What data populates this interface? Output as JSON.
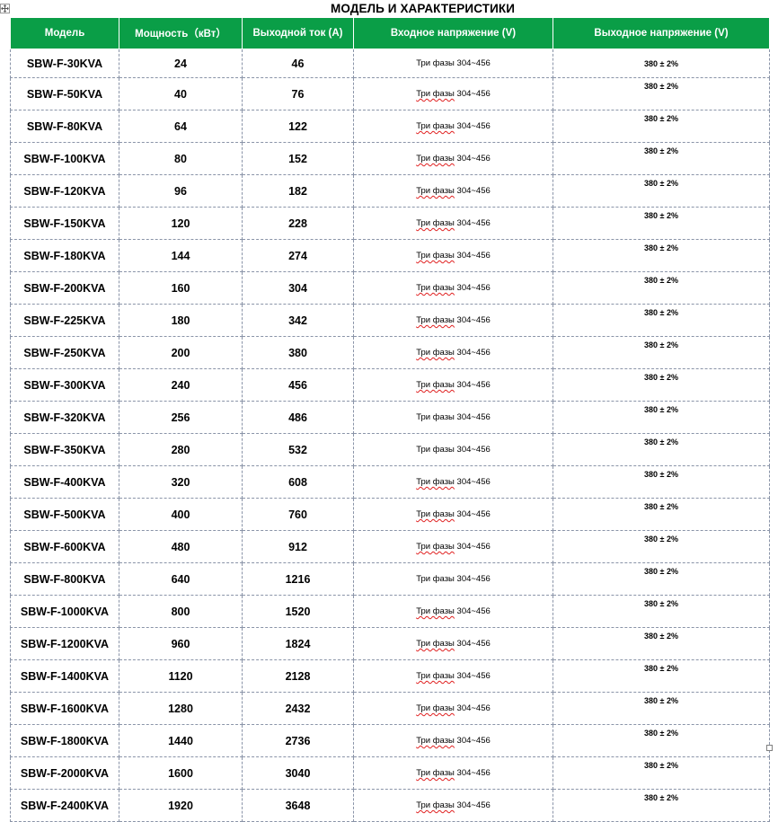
{
  "title": "МОДЕЛЬ И ХАРАКТЕРИСТИКИ",
  "headers": [
    "Модель",
    "Мощность（кВт）",
    "Выходной ток (A)",
    "Входное напряжение (V)",
    "Выходное напряжение (V)"
  ],
  "rows": [
    {
      "model": "SBW-F-30KVA",
      "power": "24",
      "current": "46",
      "input_prefix": "Три фазы",
      "input_range": "304~456",
      "output": "380 ± 2%"
    },
    {
      "model": "SBW-F-50KVA",
      "power": "40",
      "current": "76",
      "input_prefix": "Три фазы",
      "input_range": "304~456",
      "output": "380 ± 2%"
    },
    {
      "model": "SBW-F-80KVA",
      "power": "64",
      "current": "122",
      "input_prefix": "Три фазы",
      "input_range": "304~456",
      "output": "380 ± 2%"
    },
    {
      "model": "SBW-F-100KVA",
      "power": "80",
      "current": "152",
      "input_prefix": "Три фазы",
      "input_range": "304~456",
      "output": "380 ± 2%"
    },
    {
      "model": "SBW-F-120KVA",
      "power": "96",
      "current": "182",
      "input_prefix": "Три фазы",
      "input_range": "304~456",
      "output": "380 ± 2%"
    },
    {
      "model": "SBW-F-150KVA",
      "power": "120",
      "current": "228",
      "input_prefix": "Три фазы",
      "input_range": "304~456",
      "output": "380 ± 2%"
    },
    {
      "model": "SBW-F-180KVA",
      "power": "144",
      "current": "274",
      "input_prefix": "Три фазы",
      "input_range": "304~456",
      "output": "380 ± 2%"
    },
    {
      "model": "SBW-F-200KVA",
      "power": "160",
      "current": "304",
      "input_prefix": "Три фазы",
      "input_range": "304~456",
      "output": "380 ± 2%"
    },
    {
      "model": "SBW-F-225KVA",
      "power": "180",
      "current": "342",
      "input_prefix": "Три фазы",
      "input_range": "304~456",
      "output": "380 ± 2%"
    },
    {
      "model": "SBW-F-250KVA",
      "power": "200",
      "current": "380",
      "input_prefix": "Три фазы",
      "input_range": "304~456",
      "output": "380 ± 2%"
    },
    {
      "model": "SBW-F-300KVA",
      "power": "240",
      "current": "456",
      "input_prefix": "Три фазы",
      "input_range": "304~456",
      "output": "380 ± 2%"
    },
    {
      "model": "SBW-F-320KVA",
      "power": "256",
      "current": "486",
      "input_prefix": "Три фазы",
      "input_range": "304~456",
      "output": "380 ± 2%"
    },
    {
      "model": "SBW-F-350KVA",
      "power": "280",
      "current": "532",
      "input_prefix": "Три фазы",
      "input_range": "304~456",
      "output": "380 ± 2%"
    },
    {
      "model": "SBW-F-400KVA",
      "power": "320",
      "current": "608",
      "input_prefix": "Три фазы",
      "input_range": "304~456",
      "output": "380 ± 2%"
    },
    {
      "model": "SBW-F-500KVA",
      "power": "400",
      "current": "760",
      "input_prefix": "Три фазы",
      "input_range": "304~456",
      "output": "380 ± 2%"
    },
    {
      "model": "SBW-F-600KVA",
      "power": "480",
      "current": "912",
      "input_prefix": "Три фазы",
      "input_range": "304~456",
      "output": "380 ± 2%"
    },
    {
      "model": "SBW-F-800KVA",
      "power": "640",
      "current": "1216",
      "input_prefix": "Три фазы",
      "input_range": "304~456",
      "output": "380 ± 2%"
    },
    {
      "model": "SBW-F-1000KVA",
      "power": "800",
      "current": "1520",
      "input_prefix": "Три фазы",
      "input_range": "304~456",
      "output": "380 ± 2%"
    },
    {
      "model": "SBW-F-1200KVA",
      "power": "960",
      "current": "1824",
      "input_prefix": "Три фазы",
      "input_range": "304~456",
      "output": "380 ± 2%"
    },
    {
      "model": "SBW-F-1400KVA",
      "power": "1120",
      "current": "2128",
      "input_prefix": "Три фазы",
      "input_range": "304~456",
      "output": "380 ± 2%"
    },
    {
      "model": "SBW-F-1600KVA",
      "power": "1280",
      "current": "2432",
      "input_prefix": "Три фазы",
      "input_range": "304~456",
      "output": "380 ± 2%"
    },
    {
      "model": "SBW-F-1800KVA",
      "power": "1440",
      "current": "2736",
      "input_prefix": "Три фазы",
      "input_range": "304~456",
      "output": "380 ± 2%"
    },
    {
      "model": "SBW-F-2000KVA",
      "power": "1600",
      "current": "3040",
      "input_prefix": "Три фазы",
      "input_range": "304~456",
      "output": "380 ± 2%"
    },
    {
      "model": "SBW-F-2400KVA",
      "power": "1920",
      "current": "3648",
      "input_prefix": "Три фазы",
      "input_range": "304~456",
      "output": "380 ± 2%"
    }
  ],
  "spellcheck_flagged_rows": [
    1,
    2,
    3,
    4,
    5,
    6,
    7,
    8,
    9,
    10,
    13,
    14,
    15,
    17,
    18,
    19,
    20,
    21,
    22,
    23
  ],
  "colors": {
    "header_bg": "#0a9e47",
    "header_text": "#ffffff",
    "grid_line": "#8a94a8",
    "spellcheck_underline": "#e02020"
  },
  "icons": [
    "table-move-handle-icon",
    "table-resize-handle-icon"
  ]
}
